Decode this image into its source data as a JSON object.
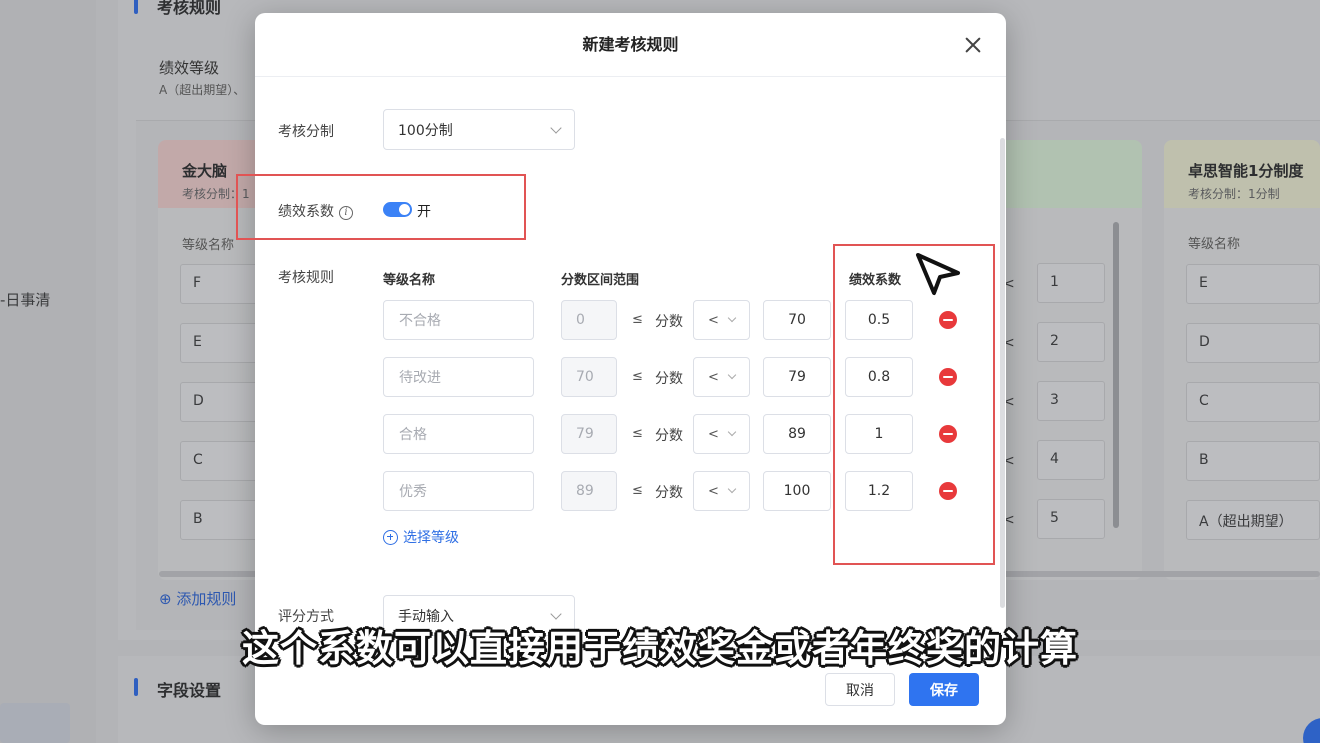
{
  "background": {
    "nav_item": "-日事清",
    "section_rules_title": "考核规则",
    "perf_level_title": "绩效等级",
    "perf_level_sub": "A（超出期望）、",
    "plan_left": {
      "name": "金大脑",
      "sub": "考核分制：1",
      "col_header": "等级名称",
      "grades": [
        "F",
        "E",
        "D",
        "C",
        "B"
      ]
    },
    "plan_right": {
      "name": "卓思智能1分制度",
      "sub": "考核分制：1分制",
      "col_header": "等级名称",
      "grades": [
        "E",
        "D",
        "C",
        "B",
        "A（超出期望）"
      ]
    },
    "middle_col": {
      "lt": [
        "<",
        "<",
        "<",
        "<",
        "<"
      ],
      "nums": [
        "1",
        "2",
        "3",
        "4",
        "5"
      ]
    },
    "add_rule": "添加规则",
    "section_fields_title": "字段设置"
  },
  "modal": {
    "title": "新建考核规则",
    "scoring_system": {
      "label": "考核分制",
      "value": "100分制"
    },
    "coefficient": {
      "label": "绩效系数",
      "toggle_on": true,
      "toggle_text": "开"
    },
    "rules": {
      "label": "考核规则",
      "headers": {
        "grade": "等级名称",
        "range": "分数区间范围",
        "coef": "绩效系数"
      },
      "leq": "≤",
      "score_word": "分数",
      "lt": "<",
      "rows": [
        {
          "grade": "不合格",
          "min": "0",
          "max": "70",
          "coef": "0.5"
        },
        {
          "grade": "待改进",
          "min": "70",
          "max": "79",
          "coef": "0.8"
        },
        {
          "grade": "合格",
          "min": "79",
          "max": "89",
          "coef": "1"
        },
        {
          "grade": "优秀",
          "min": "89",
          "max": "100",
          "coef": "1.2"
        }
      ],
      "add_grade": "选择等级"
    },
    "scoring_method": {
      "label": "评分方式",
      "value": "手动输入"
    },
    "buttons": {
      "cancel": "取消",
      "save": "保存"
    }
  },
  "subtitle": "这个系数可以直接用于绩效奖金或者年终奖的计算",
  "colors": {
    "accent": "#2f74f0",
    "annotation": "#e15454",
    "delete": "#e8393b"
  }
}
